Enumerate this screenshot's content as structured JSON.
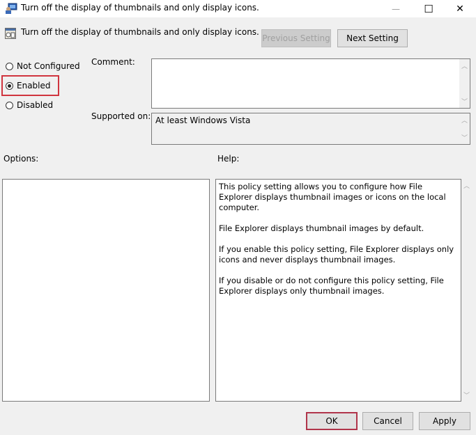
{
  "window": {
    "title": "Turn off the display of thumbnails and only display icons.",
    "minimize_glyph": "—",
    "maximize_glyph": "☐",
    "close_glyph": "✕"
  },
  "header": {
    "setting_name": "Turn off the display of thumbnails and only display icons.",
    "previous_label": "Previous Setting",
    "next_label": "Next Setting"
  },
  "state": {
    "options": [
      {
        "label": "Not Configured",
        "selected": false
      },
      {
        "label": "Enabled",
        "selected": true
      },
      {
        "label": "Disabled",
        "selected": false
      }
    ]
  },
  "comment": {
    "label": "Comment:",
    "value": ""
  },
  "supported": {
    "label": "Supported on:",
    "value": "At least Windows Vista"
  },
  "options_panel": {
    "label": "Options:"
  },
  "help_panel": {
    "label": "Help:",
    "paragraphs": [
      "This policy setting allows you to configure how File Explorer displays thumbnail images or icons on the local computer.",
      "File Explorer displays thumbnail images by default.",
      "If you enable this policy setting, File Explorer displays only icons and never displays thumbnail images.",
      "If you disable or do not configure this policy setting, File Explorer displays only thumbnail images."
    ]
  },
  "footer": {
    "ok_label": "OK",
    "cancel_label": "Cancel",
    "apply_label": "Apply"
  },
  "colors": {
    "highlight": "#d0343e",
    "background": "#f0f0f0"
  }
}
